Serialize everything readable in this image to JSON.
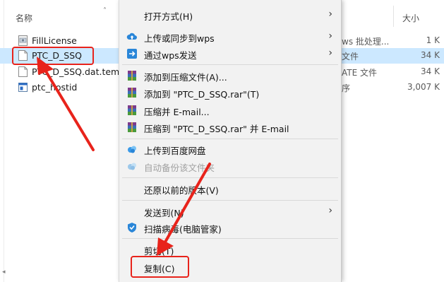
{
  "explorer": {
    "column_name": "名称",
    "column_size": "大小",
    "files": [
      {
        "name": "FillLicense",
        "type": "ws 批处理...",
        "size": "1 K"
      },
      {
        "name": "PTC_D_SSQ",
        "type": "文件",
        "size": "34 K"
      },
      {
        "name": "PTC_D_SSQ.dat.temp",
        "type": "ATE 文件",
        "size": "34 K"
      },
      {
        "name": "ptc_hostid",
        "type": "序",
        "size": "3,007 K"
      }
    ]
  },
  "menu": {
    "open_with": "打开方式(H)",
    "upload_wps": "上传或同步到wps",
    "send_wps": "通过wps发送",
    "add_archive": "添加到压缩文件(A)...",
    "add_rar": "添加到 \"PTC_D_SSQ.rar\"(T)",
    "compress_email": "压缩并 E-mail...",
    "compress_rar_email": "压缩到 \"PTC_D_SSQ.rar\" 并 E-mail",
    "baidu_upload": "上传到百度网盘",
    "baidu_backup": "自动备份该文件夹",
    "restore": "还原以前的版本(V)",
    "send_to": "发送到(N)",
    "scan_virus": "扫描病毒(电脑管家)",
    "cut": "剪切(T)",
    "copy": "复制(C)"
  },
  "colors": {
    "accent_red": "#e8231b",
    "selection": "#cce8ff",
    "menu_bg": "#f2f2f2"
  }
}
